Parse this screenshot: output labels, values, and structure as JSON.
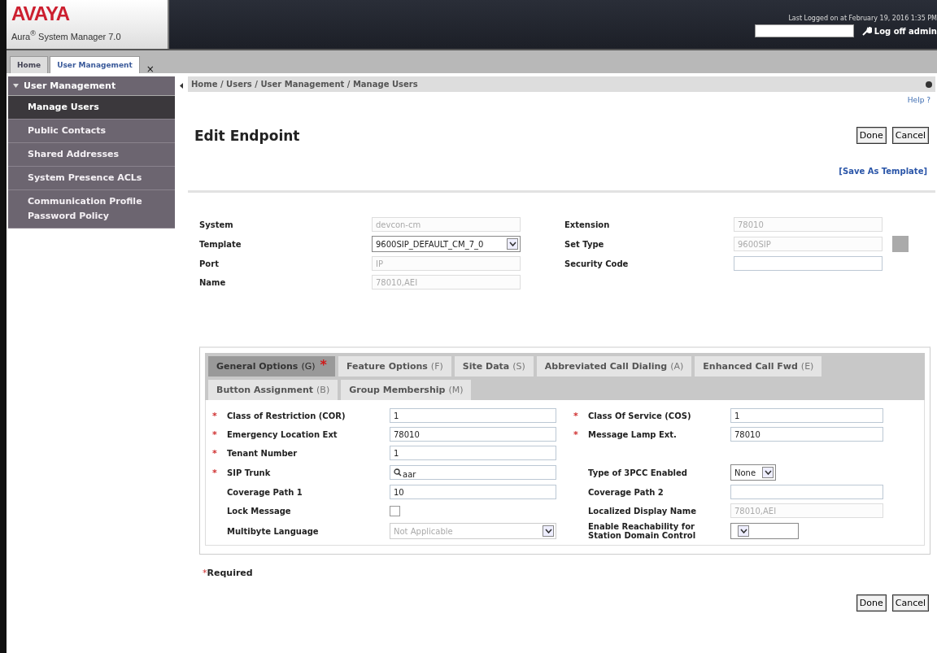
{
  "header": {
    "logo": "AVAYA",
    "product": "Aura$^{®}$ System Manager 7.0",
    "last_login": "Last Logged on at February 19, 2016 1:35 PM",
    "logoff": "Log off admin"
  },
  "page_tabs": [
    {
      "label": "Home",
      "selected": false,
      "closable": false
    },
    {
      "label": "User Management",
      "selected": true,
      "closable": true
    }
  ],
  "close_glyph": "×",
  "sidebar": {
    "title": "User Management",
    "items": [
      {
        "label": "Manage Users",
        "selected": true
      },
      {
        "label": "Public Contacts",
        "selected": false
      },
      {
        "label": "Shared Addresses",
        "selected": false
      },
      {
        "label": "System Presence ACLs",
        "selected": false
      },
      {
        "label": "Communication Profile Password Policy",
        "selected": false
      }
    ]
  },
  "breadcrumb": "Home / Users / User Management / Manage Users",
  "help": "Help ?",
  "title": "Edit Endpoint",
  "top_buttons": [
    "Done",
    "Cancel"
  ],
  "save_template": "[Save As Template]",
  "top_fields": [
    {
      "label": "System",
      "field": {
        "kind": "text",
        "value": "devcon-cm",
        "disabled": true
      }
    },
    {
      "label": "Extension",
      "field": {
        "kind": "text",
        "value": "78010",
        "disabled": true
      }
    },
    {
      "label": "Template",
      "field": {
        "kind": "select",
        "value": "9600SIP_DEFAULT_CM_7_0",
        "disabled": false
      }
    },
    {
      "label": "Set Type",
      "field": {
        "kind": "text",
        "value": "9600SIP",
        "disabled": true,
        "picker": true
      }
    },
    {
      "label": "Port",
      "field": {
        "kind": "text",
        "value": "IP",
        "disabled": true
      }
    },
    {
      "label": "Security Code",
      "field": {
        "kind": "text",
        "disabled": false
      }
    },
    {
      "label": "Name",
      "field": {
        "kind": "text",
        "value": "78010,AEI",
        "disabled": true
      }
    }
  ],
  "option_tabs": [
    {
      "label": "General Options",
      "key": "(G)",
      "selected": true,
      "flagged": true
    },
    {
      "label": "Feature Options",
      "key": "(F)",
      "selected": false,
      "flagged": false
    },
    {
      "label": "Site Data",
      "key": "(S)",
      "selected": false,
      "flagged": false
    },
    {
      "label": "Abbreviated Call Dialing",
      "key": "(A)",
      "selected": false,
      "flagged": false
    },
    {
      "label": "Enhanced Call Fwd",
      "key": "(E)",
      "selected": false,
      "flagged": false
    },
    {
      "label": "Button Assignment",
      "key": "(B)",
      "selected": false,
      "flagged": false
    },
    {
      "label": "Group Membership",
      "key": "(M)",
      "selected": false,
      "flagged": false
    }
  ],
  "required_mark": "*",
  "general_rows": [
    {
      "left": {
        "label": "Class of Restriction (COR)",
        "required": true,
        "field": {
          "kind": "text",
          "value": "1",
          "disabled": false
        }
      },
      "right": {
        "label": "Class Of Service (COS)",
        "required": true,
        "field": {
          "kind": "text",
          "value": "1",
          "disabled": false
        }
      }
    },
    {
      "left": {
        "label": "Emergency Location Ext",
        "required": true,
        "field": {
          "kind": "text",
          "value": "78010",
          "disabled": false
        }
      },
      "right": {
        "label": "Message Lamp Ext.",
        "required": true,
        "field": {
          "kind": "text",
          "value": "78010",
          "disabled": false
        }
      }
    },
    {
      "left": {
        "label": "Tenant Number",
        "required": true,
        "field": {
          "kind": "text",
          "value": "1",
          "disabled": false
        }
      }
    },
    {
      "left": {
        "label": "SIP Trunk",
        "required": true,
        "field": {
          "kind": "search",
          "value": "aar",
          "disabled": false
        }
      },
      "right": {
        "label": "Type of 3PCC Enabled",
        "required": false,
        "field": {
          "kind": "select",
          "value": "None",
          "disabled": false,
          "narrow": true
        }
      }
    },
    {
      "left": {
        "label": "Coverage Path 1",
        "required": false,
        "field": {
          "kind": "text",
          "value": "10",
          "disabled": false
        }
      },
      "right": {
        "label": "Coverage Path 2",
        "required": false,
        "field": {
          "kind": "text",
          "disabled": false
        }
      }
    },
    {
      "left": {
        "label": "Lock Message",
        "required": false,
        "field": {
          "kind": "checkbox",
          "checked": false
        }
      },
      "right": {
        "label": "Localized Display Name",
        "required": false,
        "field": {
          "kind": "text",
          "value": "78010,AEI",
          "disabled": true
        }
      }
    },
    {
      "left": {
        "label": "Multibyte Language",
        "required": false,
        "field": {
          "kind": "select",
          "value": "Not Applicable",
          "disabled": true
        }
      },
      "right": {
        "label": "Enable Reachability for Station Domain Control",
        "required": false,
        "field": {
          "kind": "select",
          "disabled": false,
          "narrow": true
        }
      }
    }
  ],
  "required_note": "Required",
  "bottom_buttons": [
    "Done",
    "Cancel"
  ]
}
